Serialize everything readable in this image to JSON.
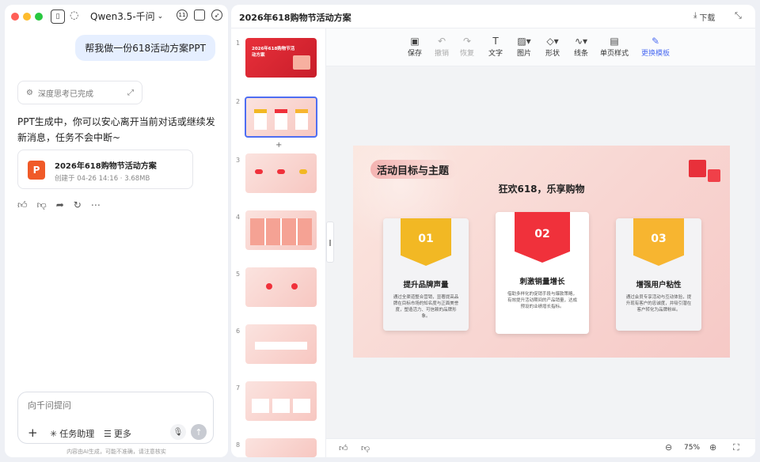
{
  "chat": {
    "model_name": "Qwen3.5-千问",
    "user_message": "帮我做一份618活动方案PPT",
    "thinking_status": "深度思考已完成",
    "assistant_message": "PPT生成中，你可以安心离开当前对话或继续发新消息，任务不会中断~",
    "file": {
      "icon_text": "P",
      "name": "2026年618购物节活动方案",
      "meta": "创建于 04-26 14:16 · 3.68MB"
    },
    "input_placeholder": "向千问提问",
    "chips": {
      "add": "+",
      "task": "任务助理",
      "more": "更多"
    },
    "disclaimer": "内容由AI生成，可能不准确，请注意核实"
  },
  "doc": {
    "title": "2026年618购物节活动方案",
    "download_label": "下载",
    "toolbar": [
      {
        "glyph": "▣",
        "label": "保存"
      },
      {
        "glyph": "↶",
        "label": "撤销"
      },
      {
        "glyph": "↷",
        "label": "恢复"
      },
      {
        "glyph": "T",
        "label": "文字"
      },
      {
        "glyph": "▨▾",
        "label": "图片"
      },
      {
        "glyph": "◇▾",
        "label": "形状"
      },
      {
        "glyph": "∿▾",
        "label": "线条"
      },
      {
        "glyph": "▤",
        "label": "单页样式"
      },
      {
        "glyph": "✎",
        "label": "更换模板"
      }
    ],
    "thumbnails": [
      "1",
      "2",
      "3",
      "4",
      "5",
      "6",
      "7",
      "8"
    ],
    "add_slide": "+",
    "zoom": "75%",
    "colors": {
      "accent": "#4e6ef2",
      "red": "#f0313b",
      "yellow": "#f2b824",
      "orange": "#f7b530"
    }
  },
  "slide": {
    "heading": "活动目标与主题",
    "subtitle": "狂欢618，乐享购物",
    "cards": [
      {
        "num": "01",
        "title": "提升品牌声量",
        "desc": "通过全渠道整合营销，显著提高品牌在目标市场的知名度与正面美誉度，塑造活力、可信赖的品牌形象。"
      },
      {
        "num": "02",
        "title": "刺激销量增长",
        "desc": "借助多样化的促销手段与爆款策略，有效提升活动期间的产品销量，达成预设的业绩增长指标。"
      },
      {
        "num": "03",
        "title": "增强用户粘性",
        "desc": "通过会员专享活动与互动体验，提升现有客户的忠诚度，并吸引潜在客户转化为品牌粉丝。"
      }
    ]
  },
  "thumb1_title": "2026年618购物节活动方案"
}
